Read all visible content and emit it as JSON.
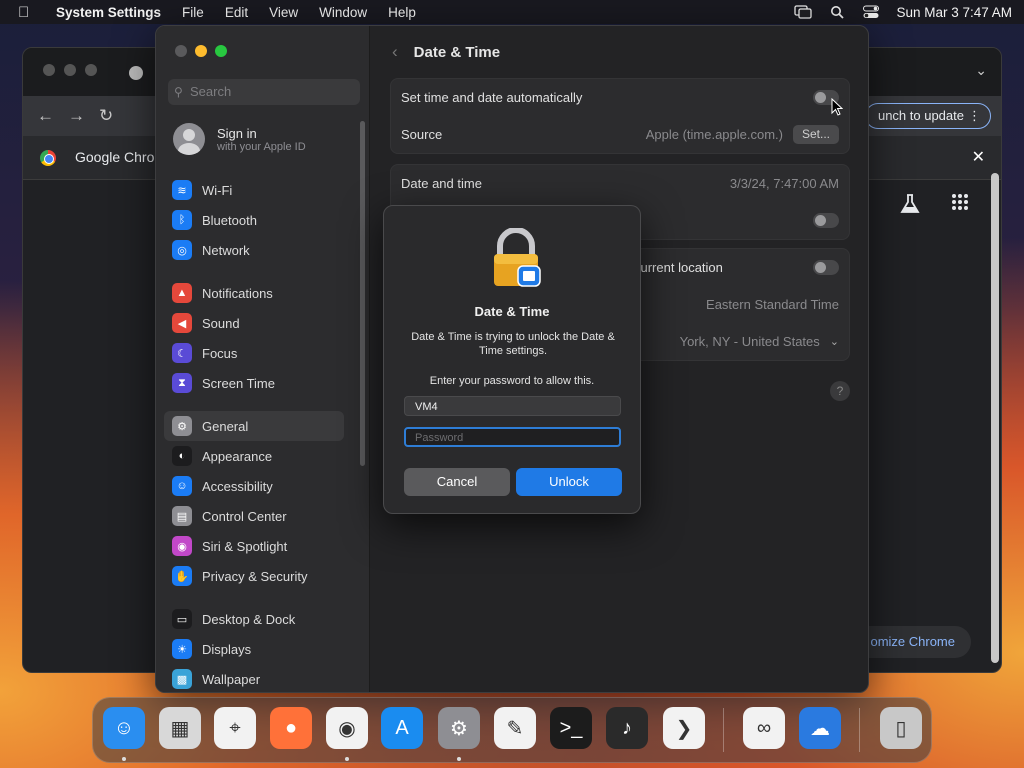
{
  "menubar": {
    "app_name": "System Settings",
    "items": [
      "File",
      "Edit",
      "View",
      "Window",
      "Help"
    ],
    "clock": "Sun Mar 3  7:47 AM"
  },
  "chrome": {
    "relaunch_label": "unch to update",
    "infobar_title": "Google Chrom",
    "customize_label": "omize Chrome"
  },
  "settings": {
    "search_placeholder": "Search",
    "signin_title": "Sign in",
    "signin_subtitle": "with your Apple ID",
    "sidebar": [
      {
        "label": "Wi-Fi",
        "color": "#1b7cf5",
        "icon": "wifi-icon"
      },
      {
        "label": "Bluetooth",
        "color": "#1b7cf5",
        "icon": "bluetooth-icon"
      },
      {
        "label": "Network",
        "color": "#1b7cf5",
        "icon": "globe-icon"
      },
      {
        "label": "Notifications",
        "color": "#e5483b",
        "icon": "bell-icon"
      },
      {
        "label": "Sound",
        "color": "#e5483b",
        "icon": "speaker-icon"
      },
      {
        "label": "Focus",
        "color": "#5a4bd6",
        "icon": "moon-icon"
      },
      {
        "label": "Screen Time",
        "color": "#5a4bd6",
        "icon": "hourglass-icon"
      },
      {
        "label": "General",
        "color": "#8e8e93",
        "icon": "gear-icon"
      },
      {
        "label": "Appearance",
        "color": "#1c1c1e",
        "icon": "appearance-icon"
      },
      {
        "label": "Accessibility",
        "color": "#1b7cf5",
        "icon": "accessibility-icon"
      },
      {
        "label": "Control Center",
        "color": "#8e8e93",
        "icon": "control-center-icon"
      },
      {
        "label": "Siri & Spotlight",
        "color": "#c248c9",
        "icon": "siri-icon"
      },
      {
        "label": "Privacy & Security",
        "color": "#1b7cf5",
        "icon": "hand-icon"
      },
      {
        "label": "Desktop & Dock",
        "color": "#1c1c1e",
        "icon": "dock-icon"
      },
      {
        "label": "Displays",
        "color": "#1b7cf5",
        "icon": "sun-icon"
      },
      {
        "label": "Wallpaper",
        "color": "#3aa3d8",
        "icon": "wallpaper-icon"
      }
    ],
    "pane": {
      "title": "Date & Time",
      "auto_label": "Set time and date automatically",
      "source_label": "Source",
      "source_value": "Apple (time.apple.com.)",
      "set_button": "Set...",
      "date_time_label": "Date and time",
      "date_time_value": "3/3/24, 7:47:00 AM",
      "location_label": "current location",
      "timezone_value": "Eastern Standard Time",
      "city_value": "York, NY - United States",
      "help": "?"
    }
  },
  "dialog": {
    "title": "Date & Time",
    "message": "Date & Time is trying to unlock the Date & Time settings.",
    "prompt": "Enter your password to allow this.",
    "username": "VM4",
    "password_placeholder": "Password",
    "cancel": "Cancel",
    "unlock": "Unlock"
  },
  "dock": {
    "apps": [
      {
        "name": "finder-icon",
        "color": "#2a8ef0"
      },
      {
        "name": "launchpad-icon",
        "color": "#d8d8d8"
      },
      {
        "name": "safari-icon",
        "color": "#f2f2f2"
      },
      {
        "name": "firefox-icon",
        "color": "#ff7139"
      },
      {
        "name": "chrome-icon",
        "color": "#f2f2f2"
      },
      {
        "name": "app-store-icon",
        "color": "#1a8cf0"
      },
      {
        "name": "system-settings-icon",
        "color": "#8e8e93"
      },
      {
        "name": "textedit-icon",
        "color": "#f2f2f2"
      },
      {
        "name": "terminal-icon",
        "color": "#1c1c1c"
      },
      {
        "name": "garageband-icon",
        "color": "#2a2a2a"
      },
      {
        "name": "vscode-icon",
        "color": "#f2f2f2"
      },
      {
        "name": "visual-studio-icon",
        "color": "#f2f2f2"
      },
      {
        "name": "weather-icon",
        "color": "#2a7ae0"
      },
      {
        "name": "trash-icon",
        "color": "#c8c8c8"
      }
    ]
  }
}
